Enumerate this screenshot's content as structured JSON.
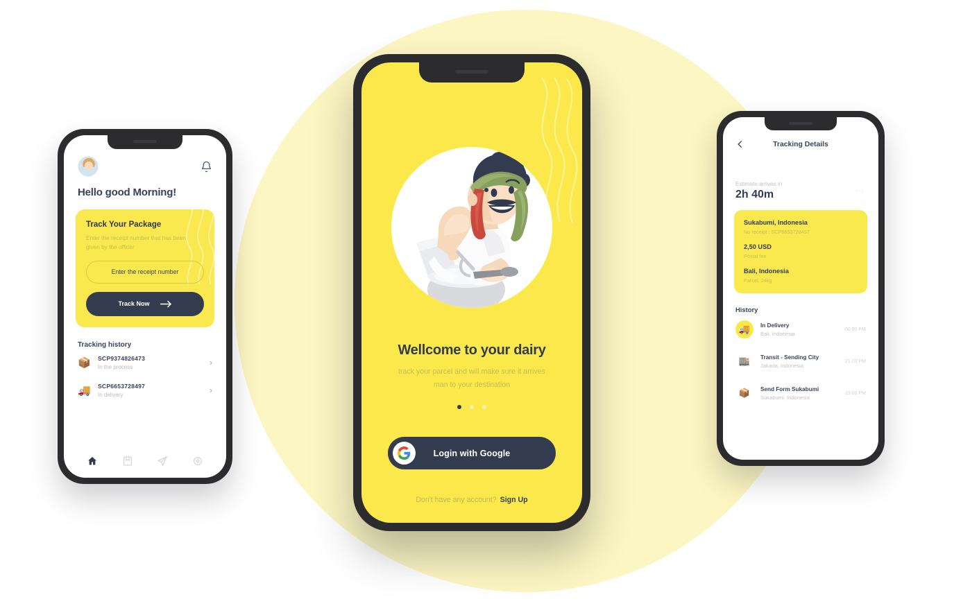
{
  "theme": {
    "yellow": "#FBE94C",
    "pale_yellow": "#FCF6C2",
    "dark": "#333C4E",
    "frame": "#2C2C2F"
  },
  "left_phone": {
    "avatar_alt": "user-avatar",
    "bell_icon": "bell-icon",
    "greeting": "Hello good Morning!",
    "track_card": {
      "title": "Track Your Package",
      "description": "Enter the receipt number that has been given by the officer",
      "input_placeholder": "Enter the receipt number",
      "button_label": "Track Now",
      "button_icon": "arrow-right-icon"
    },
    "history_title": "Tracking history",
    "history": [
      {
        "icon": "📦",
        "code": "SCP9374826473",
        "status": "In the process"
      },
      {
        "icon": "🚚",
        "code": "SCP6653728497",
        "status": "In delivery"
      }
    ],
    "nav": [
      {
        "name": "home-icon",
        "active": true
      },
      {
        "name": "bookmark-icon",
        "active": false
      },
      {
        "name": "send-icon",
        "active": false
      },
      {
        "name": "settings-icon",
        "active": false
      }
    ]
  },
  "center_phone": {
    "illustration": "dairy-farmer-illustration",
    "title": "Wellcome to your dairy",
    "subtitle": "track your parcel and will make sure it arrives man to your destination",
    "pagination": {
      "total": 3,
      "active_index": 0
    },
    "google_button": {
      "label": "Login with Google",
      "icon": "google-icon"
    },
    "signup_prompt": "Don't have any account?",
    "signup_link": "Sign Up"
  },
  "right_phone": {
    "back_icon": "chevron-left-icon",
    "title": "Tracking Details",
    "more_icon": "more-dots-icon",
    "eta": {
      "label": "Estimate arrives in",
      "value": "2h 40m"
    },
    "info": [
      {
        "title": "Sukabumi, Indonesia",
        "detail": "No receipt : SCP6653728497"
      },
      {
        "title": "2,50 USD",
        "detail": "Postal fee"
      },
      {
        "title": "Bali, Indonesia",
        "detail": "Parcel, 24kg"
      }
    ],
    "history_title": "History",
    "history": [
      {
        "icon": "🚚",
        "highlight": true,
        "title": "In Delivery",
        "location": "Bali, Indonesia",
        "time": "00.00 PM"
      },
      {
        "icon": "🏬",
        "highlight": false,
        "title": "Transit - Sending City",
        "location": "Jakarta, Indonesia",
        "time": "21.00 PM"
      },
      {
        "icon": "📦",
        "highlight": false,
        "title": "Send Form Sukabumi",
        "location": "Sukabumi, Indonesia",
        "time": "19.00 PM"
      }
    ]
  }
}
